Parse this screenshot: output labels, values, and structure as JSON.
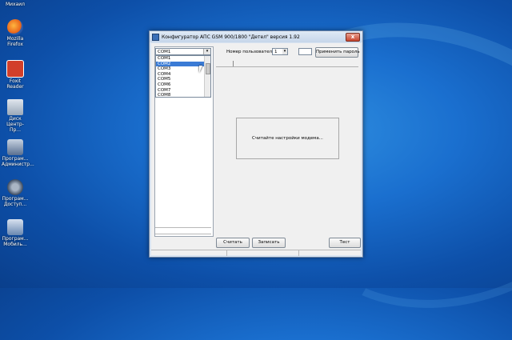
{
  "desktop": {
    "icons": [
      {
        "label": "Михаил",
        "icon": "user-folder-icon"
      },
      {
        "label": "Mozilla Firefox",
        "icon": "firefox-icon"
      },
      {
        "label": "Foxit Reader",
        "icon": "pdf-icon"
      },
      {
        "label": "Диск Центр-Пр...",
        "icon": "disk-icon"
      },
      {
        "label": "Програм... Администр...",
        "icon": "program-icon"
      },
      {
        "label": "Програм... Доступ...",
        "icon": "headset-icon"
      },
      {
        "label": "Програм... Мобиль...",
        "icon": "monitor-icon"
      }
    ]
  },
  "window": {
    "title": "Конфигуратор АПС GSM 900/1800 \"Детел\" версия 1.92",
    "close_label": "x"
  },
  "port": {
    "selected": "COM1",
    "options": [
      "COM1",
      "COM2",
      "COM3",
      "COM4",
      "COM5",
      "COM6",
      "COM7",
      "COM8"
    ],
    "highlighted_index": 1
  },
  "user": {
    "label": "Номер пользователя:",
    "selected": "1"
  },
  "apply_password_label": "Применить пароль",
  "message": "Считайте настройки модема...",
  "buttons": {
    "read": "Считать",
    "write": "Записать",
    "test": "Тест"
  }
}
